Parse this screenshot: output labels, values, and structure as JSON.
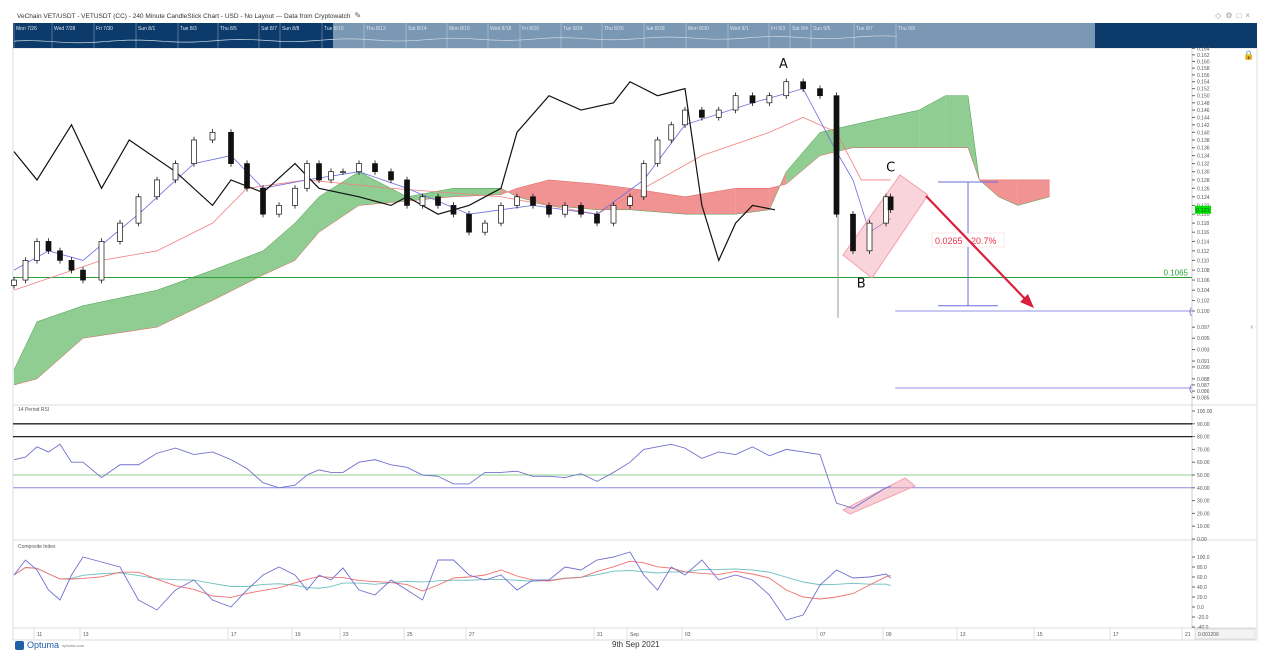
{
  "title": "VeChain VET/USDT - VETUSDT (CC) - 240 Minute CandleStick Chart - USD - No Layout --- Data from Cryptowatch",
  "window_icons": [
    "pin-icon",
    "settings-icon",
    "maximize-icon",
    "close-icon"
  ],
  "navigator": {
    "labels": [
      "Mon 7/26",
      "Wed 7/28",
      "Fri 7/30",
      "Sun 8/1",
      "Tue 8/3",
      "Thu 8/5",
      "Sat 8/7",
      "Sun 8/8",
      "Tue 8/10",
      "Thu 8/12",
      "Sat 8/14",
      "Mon 8/16",
      "Wed 8/18",
      "Fri 8/20",
      "Tue 8/24",
      "Thu 8/26",
      "Sat 8/28",
      "Mon 8/30",
      "Wed 9/1",
      "Fri 9/3",
      "Sat 9/4",
      "Sun 9/5",
      "Tue 9/7",
      "Thu 9/9"
    ],
    "colors": {
      "outside": "#0b3a6b",
      "selected": "#7a97b3"
    }
  },
  "footer": {
    "brand": "Optuma",
    "brand_url_text": "optuma.com",
    "date": "9th Sep 2021",
    "scale_readout": "0.001206"
  },
  "chart_data": [
    {
      "panel": "price",
      "type": "candlestick",
      "scale": "log",
      "ylim": [
        0.085,
        0.164
      ],
      "y_ticks": [
        0.164,
        0.162,
        0.16,
        0.158,
        0.156,
        0.154,
        0.152,
        0.15,
        0.148,
        0.146,
        0.144,
        0.142,
        0.14,
        0.138,
        0.136,
        0.134,
        0.132,
        0.13,
        0.128,
        0.126,
        0.124,
        0.122,
        0.12,
        0.118,
        0.116,
        0.114,
        0.112,
        0.11,
        0.108,
        0.106,
        0.104,
        0.102,
        0.1,
        0.097,
        0.095,
        0.093,
        0.091,
        0.09,
        0.088,
        0.087,
        0.086,
        0.085
      ],
      "last_price_label": "0.121",
      "last_price_color": "#00e000",
      "x_ticks": [
        {
          "date": "2021-08-11",
          "label": "11"
        },
        {
          "date": "2021-08-13",
          "label": "13"
        },
        {
          "date": "2021-08-17",
          "label": "17"
        },
        {
          "date": "2021-08-19",
          "label": "19"
        },
        {
          "date": "2021-08-23",
          "label": "23"
        },
        {
          "date": "2021-08-25",
          "label": "25"
        },
        {
          "date": "2021-08-27",
          "label": "27"
        },
        {
          "date": "2021-08-31",
          "label": "31"
        },
        {
          "date": "2021-09-01",
          "label": "Sep"
        },
        {
          "date": "2021-09-03",
          "label": "03"
        },
        {
          "date": "2021-09-07",
          "label": "07"
        },
        {
          "date": "2021-09-09",
          "label": "09"
        },
        {
          "date": "2021-09-13",
          "label": "13"
        },
        {
          "date": "2021-09-15",
          "label": "15"
        },
        {
          "date": "2021-09-17",
          "label": "17"
        },
        {
          "date": "2021-09-21",
          "label": "21"
        }
      ],
      "times": [
        "2021-08-10T00:00",
        "2021-08-10T12:00",
        "2021-08-11T00:00",
        "2021-08-11T12:00",
        "2021-08-12T00:00",
        "2021-08-12T12:00",
        "2021-08-13T00:00",
        "2021-08-13T12:00",
        "2021-08-14T00:00",
        "2021-08-14T12:00",
        "2021-08-15T00:00",
        "2021-08-15T12:00",
        "2021-08-16T00:00",
        "2021-08-16T12:00",
        "2021-08-17T00:00",
        "2021-08-17T12:00",
        "2021-08-18T00:00",
        "2021-08-18T12:00",
        "2021-08-19T00:00",
        "2021-08-20T00:00",
        "2021-08-21T00:00",
        "2021-08-22T00:00",
        "2021-08-23T00:00",
        "2021-08-23T12:00",
        "2021-08-24T00:00",
        "2021-08-24T12:00",
        "2021-08-25T00:00",
        "2021-08-25T12:00",
        "2021-08-26T00:00",
        "2021-08-26T12:00",
        "2021-08-27T00:00",
        "2021-08-27T12:00",
        "2021-08-28T00:00",
        "2021-08-28T12:00",
        "2021-08-29T00:00",
        "2021-08-29T12:00",
        "2021-08-30T00:00",
        "2021-08-30T12:00",
        "2021-08-31T00:00",
        "2021-08-31T12:00",
        "2021-09-01T00:00",
        "2021-09-01T12:00",
        "2021-09-02T00:00",
        "2021-09-02T12:00",
        "2021-09-03T00:00",
        "2021-09-03T12:00",
        "2021-09-04T00:00",
        "2021-09-04T12:00",
        "2021-09-05T00:00",
        "2021-09-05T12:00",
        "2021-09-06T00:00",
        "2021-09-06T12:00",
        "2021-09-07T00:00",
        "2021-09-07T12:00",
        "2021-09-08T00:00",
        "2021-09-08T12:00",
        "2021-09-09T00:00",
        "2021-09-09T06:00"
      ],
      "close": [
        0.106,
        0.11,
        0.114,
        0.112,
        0.11,
        0.108,
        0.106,
        0.114,
        0.118,
        0.124,
        0.128,
        0.132,
        0.138,
        0.14,
        0.132,
        0.126,
        0.12,
        0.122,
        0.126,
        0.132,
        0.128,
        0.13,
        0.13,
        0.132,
        0.13,
        0.128,
        0.122,
        0.124,
        0.122,
        0.12,
        0.116,
        0.118,
        0.122,
        0.124,
        0.122,
        0.12,
        0.122,
        0.12,
        0.118,
        0.122,
        0.124,
        0.132,
        0.138,
        0.142,
        0.146,
        0.144,
        0.146,
        0.15,
        0.148,
        0.15,
        0.154,
        0.152,
        0.15,
        0.12,
        0.112,
        0.118,
        0.124,
        0.121
      ],
      "lagging_span": [
        [
          "2021-08-10T00:00",
          0.135
        ],
        [
          "2021-08-11T00:00",
          0.128
        ],
        [
          "2021-08-12T12:00",
          0.142
        ],
        [
          "2021-08-13T12:00",
          0.126
        ],
        [
          "2021-08-14T06:00",
          0.138
        ],
        [
          "2021-08-15T12:00",
          0.13
        ],
        [
          "2021-08-16T12:00",
          0.122
        ],
        [
          "2021-08-17T00:00",
          0.128
        ],
        [
          "2021-08-18T00:00",
          0.125
        ],
        [
          "2021-08-19T00:00",
          0.132
        ],
        [
          "2021-08-21T00:00",
          0.126
        ],
        [
          "2021-08-23T12:00",
          0.124
        ],
        [
          "2021-08-24T12:00",
          0.122
        ],
        [
          "2021-08-25T00:00",
          0.124
        ],
        [
          "2021-08-26T00:00",
          0.12
        ],
        [
          "2021-08-27T00:00",
          0.122
        ],
        [
          "2021-08-28T00:00",
          0.126
        ],
        [
          "2021-08-28T12:00",
          0.14
        ],
        [
          "2021-08-29T12:00",
          0.15
        ],
        [
          "2021-08-30T12:00",
          0.146
        ],
        [
          "2021-08-31T12:00",
          0.148
        ],
        [
          "2021-09-01T00:00",
          0.154
        ],
        [
          "2021-09-02T00:00",
          0.15
        ],
        [
          "2021-09-03T00:00",
          0.152
        ],
        [
          "2021-09-03T12:00",
          0.122
        ],
        [
          "2021-09-04T00:00",
          0.11
        ],
        [
          "2021-09-04T12:00",
          0.118
        ],
        [
          "2021-09-05T00:00",
          0.122
        ],
        [
          "2021-09-05T16:00",
          0.121
        ]
      ],
      "base_line": [
        [
          "2021-08-10T00:00",
          0.104
        ],
        [
          "2021-08-13T12:00",
          0.11
        ],
        [
          "2021-08-15T00:00",
          0.112
        ],
        [
          "2021-08-16T12:00",
          0.118
        ],
        [
          "2021-08-17T12:00",
          0.126
        ],
        [
          "2021-08-20T00:00",
          0.128
        ],
        [
          "2021-08-24T12:00",
          0.126
        ],
        [
          "2021-08-28T00:00",
          0.124
        ],
        [
          "2021-08-31T00:00",
          0.12
        ],
        [
          "2021-09-01T12:00",
          0.126
        ],
        [
          "2021-09-03T12:00",
          0.134
        ],
        [
          "2021-09-05T12:00",
          0.14
        ],
        [
          "2021-09-06T12:00",
          0.144
        ],
        [
          "2021-09-07T12:00",
          0.14
        ],
        [
          "2021-09-08T06:00",
          0.128
        ],
        [
          "2021-09-09T06:00",
          0.128
        ]
      ],
      "conversion_line": [
        [
          "2021-08-10T00:00",
          0.108
        ],
        [
          "2021-08-11T12:00",
          0.112
        ],
        [
          "2021-08-13T00:00",
          0.11
        ],
        [
          "2021-08-14T12:00",
          0.12
        ],
        [
          "2021-08-16T00:00",
          0.132
        ],
        [
          "2021-08-17T00:00",
          0.134
        ],
        [
          "2021-08-18T00:00",
          0.126
        ],
        [
          "2021-08-20T00:00",
          0.128
        ],
        [
          "2021-08-23T12:00",
          0.13
        ],
        [
          "2021-08-25T00:00",
          0.126
        ],
        [
          "2021-08-27T00:00",
          0.12
        ],
        [
          "2021-08-29T00:00",
          0.122
        ],
        [
          "2021-08-31T00:00",
          0.12
        ],
        [
          "2021-09-01T12:00",
          0.128
        ],
        [
          "2021-09-03T00:00",
          0.142
        ],
        [
          "2021-09-05T00:00",
          0.148
        ],
        [
          "2021-09-06T12:00",
          0.152
        ],
        [
          "2021-09-07T12:00",
          0.135
        ],
        [
          "2021-09-08T00:00",
          0.128
        ],
        [
          "2021-09-08T12:00",
          0.116
        ],
        [
          "2021-09-09T06:00",
          0.119
        ]
      ],
      "cloud": {
        "colors": {
          "bullish": "#7cc47f",
          "bearish": "#f08080"
        },
        "points": [
          [
            "2021-08-10T00:00",
            0.0895,
            0.087
          ],
          [
            "2021-08-11T00:00",
            0.098,
            0.088
          ],
          [
            "2021-08-13T00:00",
            0.101,
            0.095
          ],
          [
            "2021-08-15T00:00",
            0.104,
            0.097
          ],
          [
            "2021-08-16T12:00",
            0.108,
            0.102
          ],
          [
            "2021-08-18T00:00",
            0.112,
            0.107
          ],
          [
            "2021-08-19T00:00",
            0.118,
            0.11
          ],
          [
            "2021-08-21T00:00",
            0.124,
            0.116
          ],
          [
            "2021-08-23T12:00",
            0.13,
            0.122
          ],
          [
            "2021-08-25T00:00",
            0.124,
            0.123
          ],
          [
            "2021-08-26T12:00",
            0.126,
            0.124
          ],
          [
            "2021-08-28T00:00",
            0.126,
            0.1245
          ],
          [
            "2021-08-28T12:00",
            0.124,
            0.126
          ],
          [
            "2021-08-29T12:00",
            0.122,
            0.128
          ],
          [
            "2021-08-31T00:00",
            0.121,
            0.127
          ],
          [
            "2021-09-01T00:00",
            0.121,
            0.126
          ],
          [
            "2021-09-03T00:00",
            0.12,
            0.124
          ],
          [
            "2021-09-04T12:00",
            0.12,
            0.126
          ],
          [
            "2021-09-05T12:00",
            0.121,
            0.126
          ],
          [
            "2021-09-06T00:00",
            0.13,
            0.127
          ],
          [
            "2021-09-07T00:00",
            0.14,
            0.134
          ],
          [
            "2021-09-08T00:00",
            0.142,
            0.136
          ],
          [
            "2021-09-09T00:00",
            0.144,
            0.136
          ],
          [
            "2021-09-10T19:00",
            0.146,
            0.136
          ],
          [
            "2021-09-12T05:00",
            0.15,
            0.136
          ],
          [
            "2021-09-13T05:00",
            0.15,
            0.136
          ],
          [
            "2021-09-13T12:00",
            0.128,
            0.128
          ],
          [
            "2021-09-14T00:00",
            0.124,
            0.128
          ],
          [
            "2021-09-14T12:00",
            0.122,
            0.128
          ],
          [
            "2021-09-15T08:00",
            0.124,
            0.128
          ]
        ]
      },
      "horizontal_lines": [
        {
          "value": 0.1065,
          "label": "0.1065",
          "color": "#2e9e3a"
        },
        {
          "value": 0.1,
          "color": "#6b6bdc",
          "from": "2021-09-09T12:00"
        },
        {
          "value": 0.0865,
          "color": "#6b6bdc",
          "from": "2021-09-09T12:00"
        }
      ],
      "wave_labels": [
        {
          "label": "A",
          "date": "2021-09-05T22:00",
          "value": 0.158
        },
        {
          "label": "B",
          "date": "2021-09-08T06:00",
          "value": 0.1045
        },
        {
          "label": "C",
          "date": "2021-09-09T06:00",
          "value": 0.13
        }
      ],
      "measure": {
        "from": 0.1275,
        "to": 0.101,
        "date": "2021-09-13T05:00",
        "label_value": "0.0265",
        "label_percent": "20.7%",
        "color": "#e8334a"
      },
      "arrow_color": "#d81f3d",
      "channel_color": "#f4a0b0"
    },
    {
      "panel": "rsi",
      "type": "line",
      "title": "14 Period RSI",
      "ylim": [
        0,
        100
      ],
      "y_ticks": [
        "100.00",
        "90.00",
        "80.00",
        "70.00",
        "60.00",
        "50.00",
        "40.00",
        "30.00",
        "20.00",
        "10.00",
        "0.00"
      ],
      "levels": [
        {
          "value": 90,
          "color": "#222"
        },
        {
          "value": 80,
          "color": "#222"
        },
        {
          "value": 50,
          "color": "#8fd18f"
        },
        {
          "value": 40,
          "color": "#8c8ce0"
        }
      ],
      "values": [
        62,
        64,
        72,
        68,
        74,
        60,
        60,
        48,
        58,
        58,
        67,
        71,
        66,
        68,
        62,
        55,
        44,
        40,
        42,
        50,
        54,
        52,
        52,
        60,
        62,
        58,
        56,
        50,
        49,
        43,
        43,
        52,
        52,
        53,
        49,
        49,
        48,
        51,
        45,
        52,
        60,
        70,
        72,
        74,
        71,
        63,
        68,
        66,
        72,
        65,
        70,
        68,
        66,
        28,
        24,
        32,
        40,
        41
      ],
      "color": "#7070d0"
    },
    {
      "panel": "composite",
      "type": "line",
      "title": "Composite Index",
      "ylim": [
        -40,
        100
      ],
      "y_ticks": [
        "100.0",
        "80.0",
        "60.0",
        "40.0",
        "20.0",
        "0.0",
        "-20.0",
        "-40.0"
      ],
      "values": [
        64,
        94,
        74,
        34,
        14,
        64,
        100,
        90,
        80,
        14,
        -6,
        34,
        54,
        14,
        0,
        34,
        64,
        80,
        64,
        34,
        64,
        54,
        78,
        34,
        24,
        54,
        34,
        14,
        94,
        94,
        64,
        54,
        64,
        34,
        54,
        54,
        80,
        74,
        94,
        100,
        110,
        64,
        34,
        80,
        64,
        94,
        54,
        64,
        54,
        24,
        -26,
        -16,
        44,
        74,
        58,
        60,
        66,
        58
      ],
      "color": "#7070d0",
      "average_colors": [
        "#f07070",
        "#70c0c0"
      ]
    }
  ]
}
